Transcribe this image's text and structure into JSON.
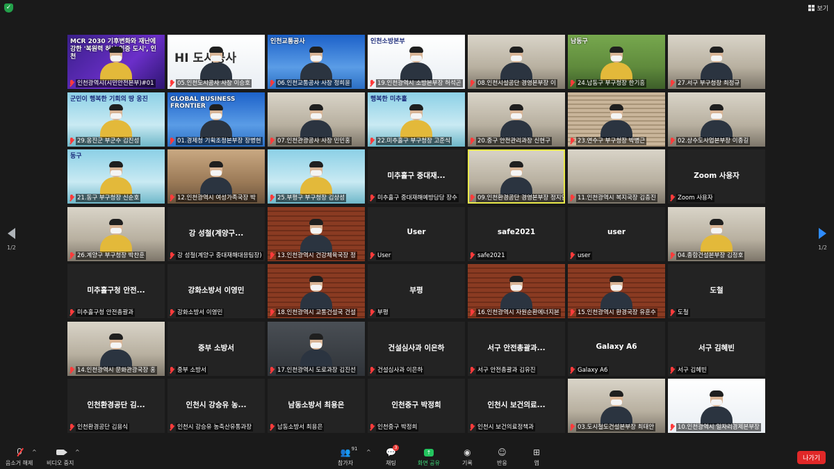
{
  "topbar": {
    "view_label": "보기",
    "shield_glyph": "✓"
  },
  "tiles": [
    {
      "style": "c-purple",
      "person": "yellow",
      "overlay": "MCR 2030  기후변화와 재난에 강한 '복원력 허브 인증 도시', 인천",
      "overlay_class": "light",
      "label": "인천광역시(시민안전본부)#01"
    },
    {
      "style": "c-white",
      "person": "dark",
      "overlay": "HI 도시공사",
      "overlay_class": "big",
      "label": "05.인천도시공사 사장 이승호"
    },
    {
      "style": "c-blue",
      "person": "dark",
      "overlay": "인천교통공사",
      "overlay_class": "light",
      "label": "06.인천교통공사 사장 정희윤"
    },
    {
      "style": "c-white",
      "person": "dark",
      "overlay": "인천소방본부",
      "overlay_class": "",
      "label": "19.인천광역시 소방본부장 허석곤"
    },
    {
      "style": "c-office",
      "person": "dark",
      "overlay": "",
      "overlay_class": "",
      "label": "08.인천시설공단 경영본부장 이"
    },
    {
      "style": "c-green",
      "person": "yellow",
      "overlay": "남동구",
      "overlay_class": "light",
      "label": "24.남동구 부구청장 한기흥"
    },
    {
      "style": "c-office",
      "person": "dark",
      "overlay": "",
      "overlay_class": "",
      "label": "27.서구 부구청장 최정규"
    },
    {
      "style": "c-teal",
      "person": "yellow",
      "overlay": "군민이 행복한 기회의 땅 옹진",
      "overlay_class": "",
      "label": "29.옹진군 부군수 김진성"
    },
    {
      "style": "c-blue",
      "person": "dark",
      "overlay": "GLOBAL BUSINESS FRONTIER",
      "overlay_class": "light",
      "label": "01.경제청 기획조정본부장 장병현"
    },
    {
      "style": "c-office",
      "person": "dark",
      "overlay": "",
      "overlay_class": "",
      "label": "07.인천관광공사 사장 민민홍"
    },
    {
      "style": "c-teal",
      "person": "yellow",
      "overlay": "행복한 미추홀",
      "overlay_class": "",
      "label": "22.미추홀구 부구청장 고준식"
    },
    {
      "style": "c-office",
      "person": "dark",
      "overlay": "",
      "overlay_class": "",
      "label": "20.중구 안전관리과장 신현구"
    },
    {
      "style": "c-blind",
      "person": "dark",
      "overlay": "",
      "overlay_class": "",
      "label": "23.연수구 부구청장 박병근"
    },
    {
      "style": "c-office",
      "person": "dark",
      "overlay": "",
      "overlay_class": "",
      "label": "02.상수도사업본부장 이종길"
    },
    {
      "style": "c-teal",
      "person": "yellow",
      "overlay": "동구",
      "overlay_class": "",
      "label": "21.동구 부구청장 신순호"
    },
    {
      "style": "c-warm",
      "person": "dark",
      "overlay": "",
      "overlay_class": "",
      "label": "12.인천광역시 여성가족국장 박"
    },
    {
      "style": "c-teal",
      "person": "yellow",
      "overlay": "",
      "overlay_class": "",
      "label": "25.부평구 부구청장 김상성"
    },
    {
      "style": "name",
      "name": "미추홀구 중대재...",
      "label": "미추홀구 중대재해예방담당 장수"
    },
    {
      "style": "c-office",
      "person": "dark",
      "active": true,
      "overlay": "",
      "overlay_class": "",
      "label": "09.인천환경공단 경영본부장 정지열"
    },
    {
      "style": "c-office",
      "person": "none",
      "overlay": "",
      "overlay_class": "",
      "label": "11.인천광역시 복지국장 김충진"
    },
    {
      "style": "name",
      "name": "Zoom 사용자",
      "label": "Zoom 사용자"
    },
    {
      "style": "c-office",
      "person": "yellow",
      "overlay": "",
      "overlay_class": "",
      "label": "26.계양구 부구청장 박찬훈"
    },
    {
      "style": "name",
      "name": "강 성철(계양구...",
      "label": "강 성철(계양구 중대재해대응팀장)"
    },
    {
      "style": "c-wood",
      "person": "dark",
      "overlay": "",
      "overlay_class": "",
      "label": "13.인천광역시 건강체육국장 정"
    },
    {
      "style": "name",
      "name": "User",
      "label": "User"
    },
    {
      "style": "name",
      "name": "safe2021",
      "label": "safe2021"
    },
    {
      "style": "name",
      "name": "user",
      "label": "user"
    },
    {
      "style": "c-office",
      "person": "yellow",
      "overlay": "",
      "overlay_class": "",
      "label": "04.종합건설본부장 김정호"
    },
    {
      "style": "name",
      "name": "미추홀구청 안전...",
      "label": "미추홀구청 안전총괄과"
    },
    {
      "style": "name",
      "name": "강화소방서 이영민",
      "label": "강화소방서 이영민"
    },
    {
      "style": "c-wood",
      "person": "dark",
      "overlay": "",
      "overlay_class": "",
      "label": "18.인천광역시 교통건설국 건설"
    },
    {
      "style": "name",
      "name": "부평",
      "label": "부평"
    },
    {
      "style": "c-wood",
      "person": "dark",
      "overlay": "",
      "overlay_class": "",
      "label": "16.인천광역시 자원순환에너지본"
    },
    {
      "style": "c-wood",
      "person": "dark",
      "overlay": "",
      "overlay_class": "",
      "label": "15.인천광역시 환경국장 유훈수"
    },
    {
      "style": "name",
      "name": "도철",
      "label": "도철"
    },
    {
      "style": "c-office",
      "person": "dark",
      "overlay": "",
      "overlay_class": "",
      "label": "14.인천광역시 문화관광국장 홍"
    },
    {
      "style": "name",
      "name": "중부 소방서",
      "label": "중부 소방서"
    },
    {
      "style": "c-dark",
      "person": "dark",
      "overlay": "",
      "overlay_class": "",
      "label": "17.인천광역시 도로과장 김진선"
    },
    {
      "style": "name",
      "name": "건설심사과 이은하",
      "label": "건설심사과 이은하"
    },
    {
      "style": "name",
      "name": "서구 안전총괄과...",
      "label": "서구 안전총괄과 김유진"
    },
    {
      "style": "name",
      "name": "Galaxy A6",
      "label": "Galaxy A6"
    },
    {
      "style": "name",
      "name": "서구 김혜빈",
      "label": "서구 김혜빈"
    },
    {
      "style": "name",
      "name": "인천환경공단 김...",
      "label": "인천환경공단 김용식"
    },
    {
      "style": "name",
      "name": "인천시 강승유 농...",
      "label": "인천시 강승유 농축산유통과장"
    },
    {
      "style": "name",
      "name": "남동소방서 최용은",
      "label": "남동소방서 최용은"
    },
    {
      "style": "name",
      "name": "인천중구 박정희",
      "label": "인천중구 박정희"
    },
    {
      "style": "name",
      "name": "인천시 보건의료...",
      "label": "인천시 보건의료정책과"
    },
    {
      "style": "c-office",
      "person": "dark",
      "overlay": "",
      "overlay_class": "",
      "label": "03.도시철도건설본부장 최태안"
    },
    {
      "style": "c-white",
      "person": "dark",
      "overlay": "",
      "overlay_class": "",
      "label": "10.인천광역시 일자리경제본부장"
    }
  ],
  "pager": {
    "left_page": "1/2",
    "right_page": "1/2"
  },
  "toolbar": {
    "mute_label": "음소거 해제",
    "video_label": "비디오 중지",
    "participants_label": "참가자",
    "participants_count": "91",
    "chat_label": "채팅",
    "chat_badge": "3",
    "share_label": "화면 공유",
    "record_label": "기록",
    "reactions_label": "반응",
    "apps_label": "앱",
    "leave_label": "나가기"
  }
}
